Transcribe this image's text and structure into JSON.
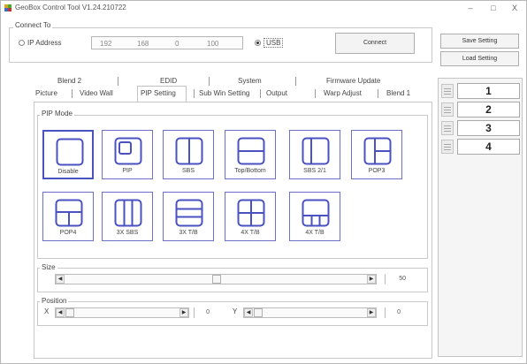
{
  "window": {
    "title": "GeoBox Control Tool  V1.24.210722",
    "minimize": "–",
    "maximize": "□",
    "close": "X"
  },
  "connect": {
    "group_label": "Connect To",
    "ip_label": "IP Address",
    "ip_octets": [
      "192",
      "168",
      "0",
      "100"
    ],
    "usb_label": "USB",
    "selected": "USB",
    "connect_button": "Connect"
  },
  "right_panel": {
    "save_button": "Save Setting",
    "load_button": "Load Setting",
    "presets": [
      "1",
      "2",
      "3",
      "4"
    ]
  },
  "tabs": {
    "row1": [
      "Blend 2",
      "EDID",
      "System",
      "Firmware Update"
    ],
    "row2": [
      "Picture",
      "Video Wall",
      "PIP Setting",
      "Sub Win Setting",
      "Output",
      "Warp Adjust",
      "Blend 1"
    ],
    "active": "PIP Setting"
  },
  "pip_mode": {
    "group_label": "PIP Mode",
    "selected": "Disable",
    "modes": [
      {
        "label": "Disable",
        "icon": "disable-icon"
      },
      {
        "label": "PIP",
        "icon": "pip-icon"
      },
      {
        "label": "SBS",
        "icon": "sbs-icon"
      },
      {
        "label": "Top/Bottom",
        "icon": "top-bottom-icon"
      },
      {
        "label": "SBS 2/1",
        "icon": "sbs-2-1-icon"
      },
      {
        "label": "POP3",
        "icon": "pop3-icon"
      },
      {
        "label": "POP4",
        "icon": "pop4-icon"
      },
      {
        "label": "3X SBS",
        "icon": "3x-sbs-icon"
      },
      {
        "label": "3X T/B",
        "icon": "3x-tb-icon"
      },
      {
        "label": "4X T/B",
        "icon": "4x-tb-icon"
      },
      {
        "label": "4X T/B",
        "icon": "4x-tb-alt-icon"
      }
    ]
  },
  "size": {
    "group_label": "Size",
    "value": "50"
  },
  "position": {
    "group_label": "Position",
    "x_label": "X",
    "x_value": "0",
    "y_label": "Y",
    "y_value": "0"
  },
  "colors": {
    "tile_border": "#6b70c8",
    "tile_icon": "#4a52c0"
  }
}
